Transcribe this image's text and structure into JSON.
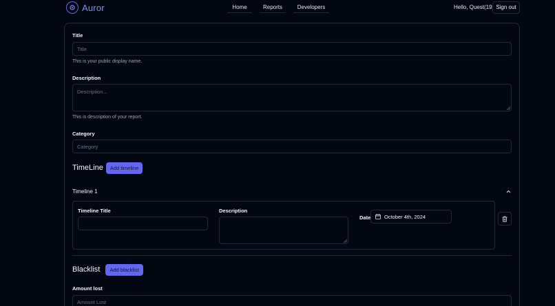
{
  "app": {
    "name": "Auror"
  },
  "nav": {
    "items": [
      "Home",
      "Reports",
      "Developers"
    ]
  },
  "user": {
    "greeting": "Hello, Quest(19)",
    "signout_label": "Sign out"
  },
  "form": {
    "title": {
      "label": "Title",
      "placeholder": "Title",
      "help": "This is your public display name."
    },
    "description": {
      "label": "Description",
      "placeholder": "Description...",
      "help": "This is description of your report."
    },
    "category": {
      "label": "Category",
      "placeholder": "Category"
    },
    "timeline": {
      "section_title": "TimeLine",
      "add_button": "Add timeline",
      "items": [
        {
          "header": "Timeline 1",
          "title_label": "Timeline Title",
          "title_value": "",
          "description_label": "Description",
          "description_value": "",
          "date_label": "Date",
          "date_value": "October 4th, 2024"
        }
      ]
    },
    "blacklist": {
      "section_title": "Blacklist",
      "add_button": "Add blacklist",
      "amount_label": "Amount lost",
      "amount_placeholder": "Amount Lost"
    }
  },
  "colors": {
    "accent": "#6366f1",
    "background": "#030712",
    "border": "#1f2937"
  }
}
